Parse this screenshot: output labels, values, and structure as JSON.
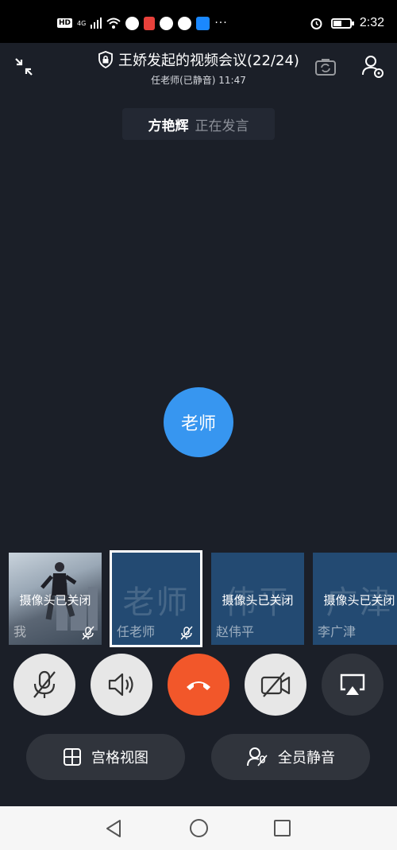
{
  "status_bar": {
    "left_icons": [
      "hd-icon",
      "4g-signal-icon",
      "wifi-icon",
      "app-icon",
      "mic-icon",
      "app-icon",
      "wechat-icon",
      "alipay-icon"
    ],
    "hd_label": "HD",
    "network_label": "4G",
    "more": "···",
    "time": "2:32"
  },
  "header": {
    "title": "王娇发起的视频会议(22/24)",
    "subtitle": "任老师(已静音) 11:47"
  },
  "speaking": {
    "name": "方艳辉",
    "status": "正在发言"
  },
  "main_avatar": {
    "label": "老师",
    "color": "#3796f0"
  },
  "thumbnails": [
    {
      "name": "我",
      "overlay": "摄像头已关闭",
      "big": "",
      "muted": true,
      "selected": false
    },
    {
      "name": "任老师",
      "overlay": "",
      "big": "老师",
      "muted": true,
      "selected": true
    },
    {
      "name": "赵伟平",
      "overlay": "摄像头已关闭",
      "big": "伟平",
      "muted": false,
      "selected": false
    },
    {
      "name": "李广津",
      "overlay": "摄像头已关闭",
      "big": "广津",
      "muted": false,
      "selected": false
    }
  ],
  "controls": {
    "mic": "mic-muted-icon",
    "speaker": "speaker-icon",
    "hangup": "hangup-icon",
    "camera": "camera-off-icon",
    "screen": "screen-share-icon",
    "end_color": "#f2572a"
  },
  "bottom": {
    "grid_label": "宫格视图",
    "mute_all_label": "全员静音"
  }
}
